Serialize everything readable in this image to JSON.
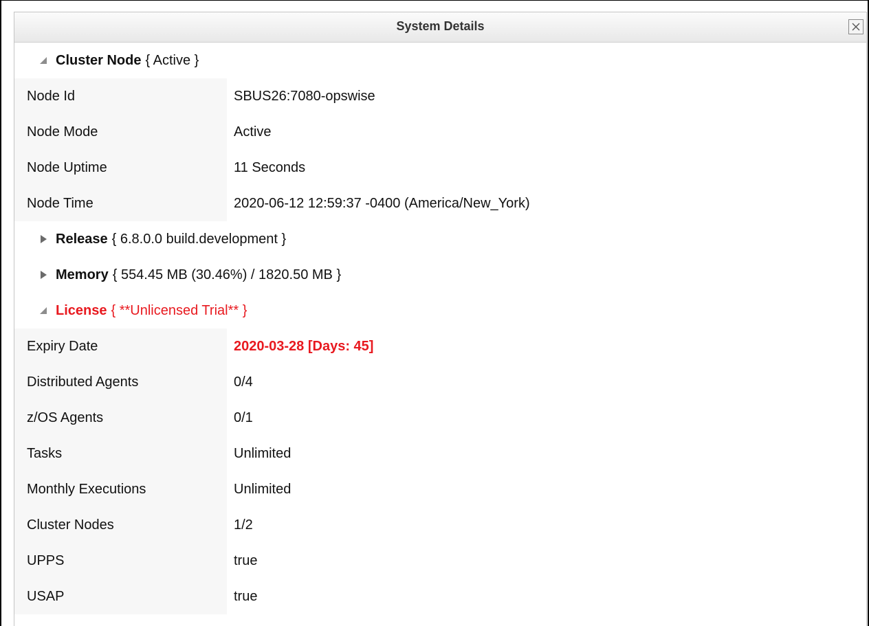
{
  "dialog": {
    "title": "System Details",
    "close_label": "Close"
  },
  "cluster_node": {
    "heading": "Cluster Node",
    "status": "{ Active }",
    "expanded": true,
    "rows": [
      {
        "label": "Node Id",
        "value": "SBUS26:7080-opswise"
      },
      {
        "label": "Node Mode",
        "value": "Active"
      },
      {
        "label": "Node Uptime",
        "value": "11 Seconds"
      },
      {
        "label": "Node Time",
        "value": "2020-06-12 12:59:37 -0400 (America/New_York)"
      }
    ]
  },
  "release": {
    "heading": "Release",
    "status": "{ 6.8.0.0 build.development }",
    "expanded": false
  },
  "memory": {
    "heading": "Memory",
    "status": "{ 554.45 MB (30.46%) / 1820.50 MB }",
    "expanded": false
  },
  "license": {
    "heading": "License",
    "status": "{ **Unlicensed Trial** }",
    "expanded": true,
    "rows": [
      {
        "label": "Expiry Date",
        "value": "2020-03-28 [Days: 45]"
      },
      {
        "label": "Distributed Agents",
        "value": "0/4"
      },
      {
        "label": "z/OS Agents",
        "value": "0/1"
      },
      {
        "label": "Tasks",
        "value": "Unlimited"
      },
      {
        "label": "Monthly Executions",
        "value": "Unlimited"
      },
      {
        "label": "Cluster Nodes",
        "value": "1/2"
      },
      {
        "label": "UPPS",
        "value": "true"
      },
      {
        "label": "USAP",
        "value": "true"
      }
    ]
  },
  "colors": {
    "warning": "#e8191f",
    "label_bg": "#f7f7f7",
    "titlebar": "#eeeeee"
  }
}
